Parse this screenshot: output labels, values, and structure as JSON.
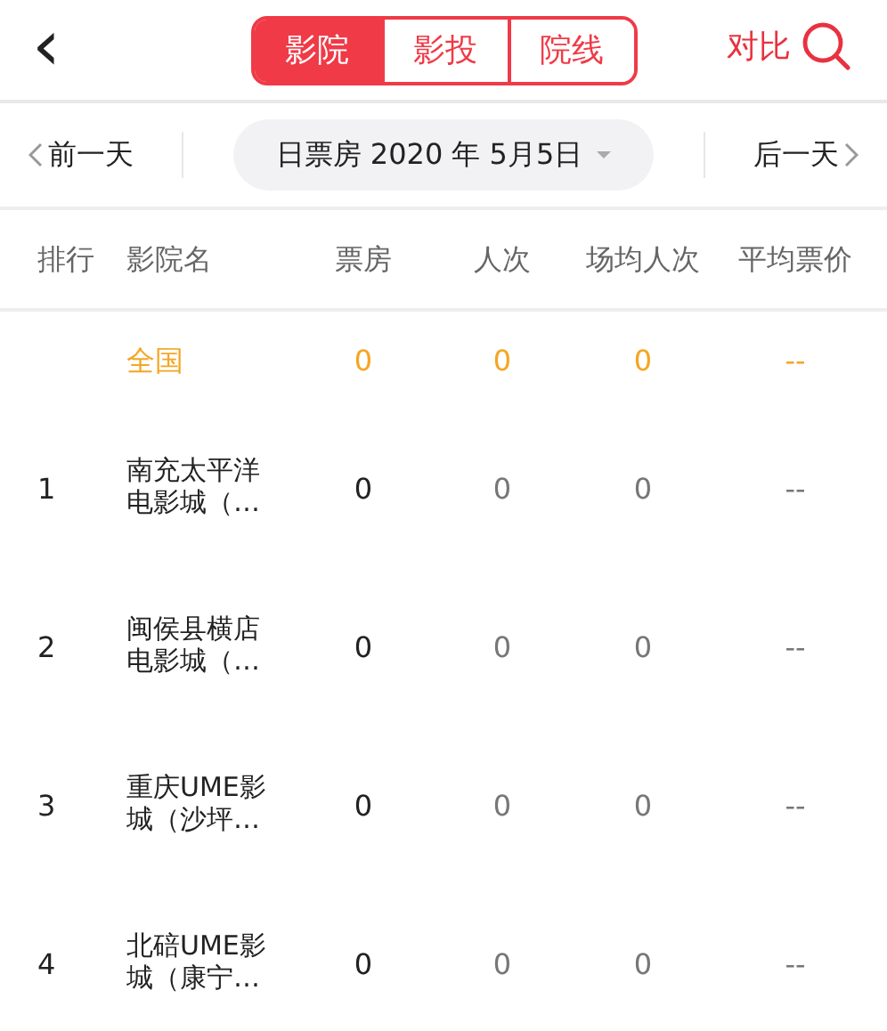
{
  "header": {
    "back": "‹",
    "tabs": [
      {
        "label": "影院",
        "selected": true
      },
      {
        "label": "影投",
        "selected": false
      },
      {
        "label": "院线",
        "selected": false
      }
    ],
    "compare": "对比"
  },
  "date_bar": {
    "prev": "前一天",
    "date": "日票房 2020 年 5月5日",
    "next": "后一天"
  },
  "table": {
    "columns": [
      "排行",
      "影院名",
      "票房",
      "人次",
      "场均人次",
      "平均票价"
    ],
    "rows": [
      {
        "kind": "total",
        "rank": "",
        "name": "全国",
        "box_office": "0",
        "admissions": "0",
        "avg_per_show": "0",
        "avg_price": "--"
      },
      {
        "kind": "cinema",
        "rank": "1",
        "name": "南充太平洋电影城（…",
        "box_office": "0",
        "admissions": "0",
        "avg_per_show": "0",
        "avg_price": "--"
      },
      {
        "kind": "cinema",
        "rank": "2",
        "name": "闽侯县横店电影城（…",
        "box_office": "0",
        "admissions": "0",
        "avg_per_show": "0",
        "avg_price": "--"
      },
      {
        "kind": "cinema",
        "rank": "3",
        "name": "重庆UME影城（沙坪…",
        "box_office": "0",
        "admissions": "0",
        "avg_per_show": "0",
        "avg_price": "--"
      },
      {
        "kind": "cinema",
        "rank": "4",
        "name": "北碚UME影城（康宁…",
        "box_office": "0",
        "admissions": "0",
        "avg_per_show": "0",
        "avg_price": "--"
      }
    ]
  }
}
